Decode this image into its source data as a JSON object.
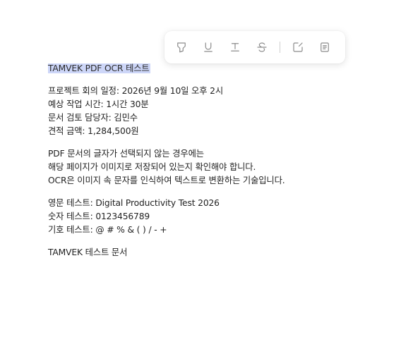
{
  "toolbar": {
    "icons": [
      {
        "name": "highlighter-icon"
      },
      {
        "name": "underline-icon"
      },
      {
        "name": "text-format-icon"
      },
      {
        "name": "strikethrough-icon"
      },
      {
        "name": "edit-note-icon"
      },
      {
        "name": "copy-text-icon"
      }
    ]
  },
  "document": {
    "selected_title": "TAMVEK PDF OCR 테스트",
    "schedule": "프로젝트 회의 일정: 2026년 9월 10일 오후 2시",
    "expected_time": "예상 작업 시간: 1시간 30분",
    "reviewer": "문서 검토 담당자: 김민수",
    "estimate": "견적 금액: 1,284,500원",
    "para1": "PDF 문서의 글자가 선택되지 않는 경우에는",
    "para2": "해당 페이지가 이미지로 저장되어 있는지 확인해야 합니다.",
    "para3": "OCR은 이미지 속 문자를 인식하여 텍스트로 변환하는 기술입니다.",
    "english_test": "영문 테스트: Digital Productivity Test 2026",
    "number_test": "숫자 테스트: 0123456789",
    "symbol_test": "기호 테스트: @ # % & ( ) / - +",
    "footer_title": "TAMVEK 테스트 문서"
  },
  "colors": {
    "selection": "#cdd6f8",
    "icon": "#8c8c8c",
    "text": "#222222"
  }
}
